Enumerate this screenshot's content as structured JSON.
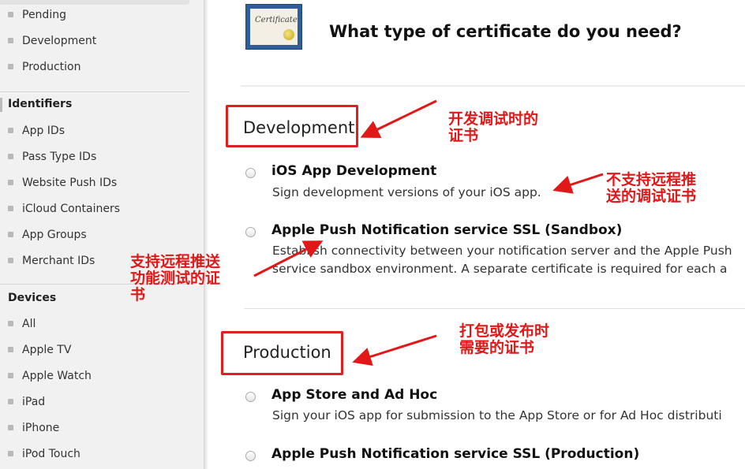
{
  "sidebar": {
    "cert_items": [
      {
        "label": "Pending"
      },
      {
        "label": "Development"
      },
      {
        "label": "Production"
      }
    ],
    "identifiers_heading": "Identifiers",
    "identifier_items": [
      {
        "label": "App IDs"
      },
      {
        "label": "Pass Type IDs"
      },
      {
        "label": "Website Push IDs"
      },
      {
        "label": "iCloud Containers"
      },
      {
        "label": "App Groups"
      },
      {
        "label": "Merchant IDs"
      }
    ],
    "devices_heading": "Devices",
    "device_items": [
      {
        "label": "All"
      },
      {
        "label": "Apple TV"
      },
      {
        "label": "Apple Watch"
      },
      {
        "label": "iPad"
      },
      {
        "label": "iPhone"
      },
      {
        "label": "iPod Touch"
      }
    ]
  },
  "main": {
    "cert_icon_text": "Certificate",
    "title": "What type of certificate do you need?",
    "development": {
      "heading": "Development",
      "options": [
        {
          "title": "iOS App Development",
          "desc": "Sign development versions of your iOS app."
        },
        {
          "title": "Apple Push Notification service SSL (Sandbox)",
          "desc1": "Establish connectivity between your notification server and the Apple Push",
          "desc2": "service sandbox environment. A separate certificate is required for each a"
        }
      ]
    },
    "production": {
      "heading": "Production",
      "options": [
        {
          "title": "App Store and Ad Hoc",
          "desc": "Sign your iOS app for submission to the App Store or for Ad Hoc distributi"
        },
        {
          "title": "Apple Push Notification service SSL (Production)"
        }
      ]
    }
  },
  "annotations": {
    "dev_note_1": "开发调试时的",
    "dev_note_2": "证书",
    "no_push_1": "不支持远程推",
    "no_push_2": "送的调试证书",
    "push_1": "支持远程推送",
    "push_2": "功能测试的证",
    "push_3": "书",
    "prod_1": "打包或发布时",
    "prod_2": "需要的证书"
  },
  "colors": {
    "annotation_red": "#e21818",
    "sidebar_bg": "#f1f1f1"
  }
}
